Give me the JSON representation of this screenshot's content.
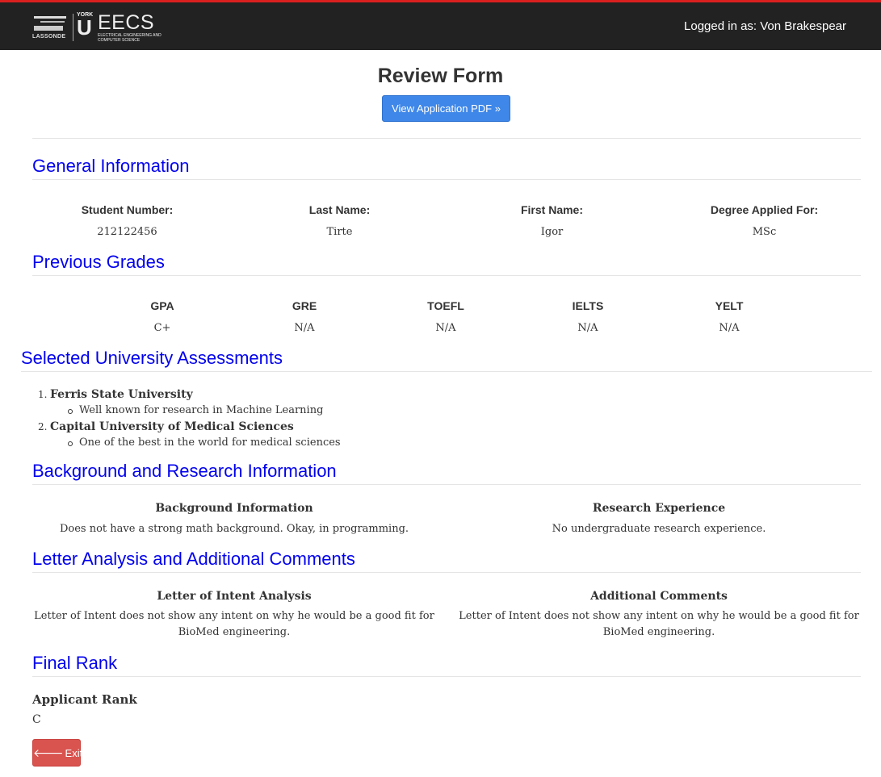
{
  "header": {
    "logo": {
      "lassonde_text": "LASSONDE",
      "york_text": "YORK",
      "u_text": "U",
      "eecs_text": "EECS",
      "eecs_subtext": "ELECTRICAL ENGINEERING AND COMPUTER SCIENCE"
    },
    "login_text": "Logged in as: Von Brakespear"
  },
  "page": {
    "title": "Review Form",
    "pdf_button": "View Application PDF »"
  },
  "general": {
    "title": "General Information",
    "fields": [
      {
        "label": "Student Number:",
        "value": "212122456"
      },
      {
        "label": "Last Name:",
        "value": "Tirte"
      },
      {
        "label": "First Name:",
        "value": "Igor"
      },
      {
        "label": "Degree Applied For:",
        "value": "MSc"
      }
    ]
  },
  "grades": {
    "title": "Previous Grades",
    "fields": [
      {
        "label": "GPA",
        "value": "C+"
      },
      {
        "label": "GRE",
        "value": "N/A"
      },
      {
        "label": "TOEFL",
        "value": "N/A"
      },
      {
        "label": "IELTS",
        "value": "N/A"
      },
      {
        "label": "YELT",
        "value": "N/A"
      }
    ]
  },
  "universities": {
    "title": "Selected University Assessments",
    "items": [
      {
        "num": "1.",
        "name": "Ferris State University",
        "note": "Well known for research in Machine Learning"
      },
      {
        "num": "2.",
        "name": "Capital University of Medical Sciences",
        "note": "One of the best in the world for medical sciences"
      }
    ]
  },
  "background": {
    "title": "Background and Research Information",
    "left": {
      "heading": "Background Information",
      "text": "Does not have a strong math background. Okay, in programming."
    },
    "right": {
      "heading": "Research Experience",
      "text": "No undergraduate research experience."
    }
  },
  "letter": {
    "title": "Letter Analysis and Additional Comments",
    "left": {
      "heading": "Letter of Intent Analysis",
      "text": "Letter of Intent does not show any intent on why he would be a good fit for BioMed engineering."
    },
    "right": {
      "heading": "Additional Comments",
      "text": "Letter of Intent does not show any intent on why he would be a good fit for BioMed engineering."
    }
  },
  "final": {
    "title": "Final Rank",
    "rank_label": "Applicant Rank",
    "rank_value": "C",
    "exit_label": "Exit",
    "exit_icon": "arrow-left-icon"
  }
}
